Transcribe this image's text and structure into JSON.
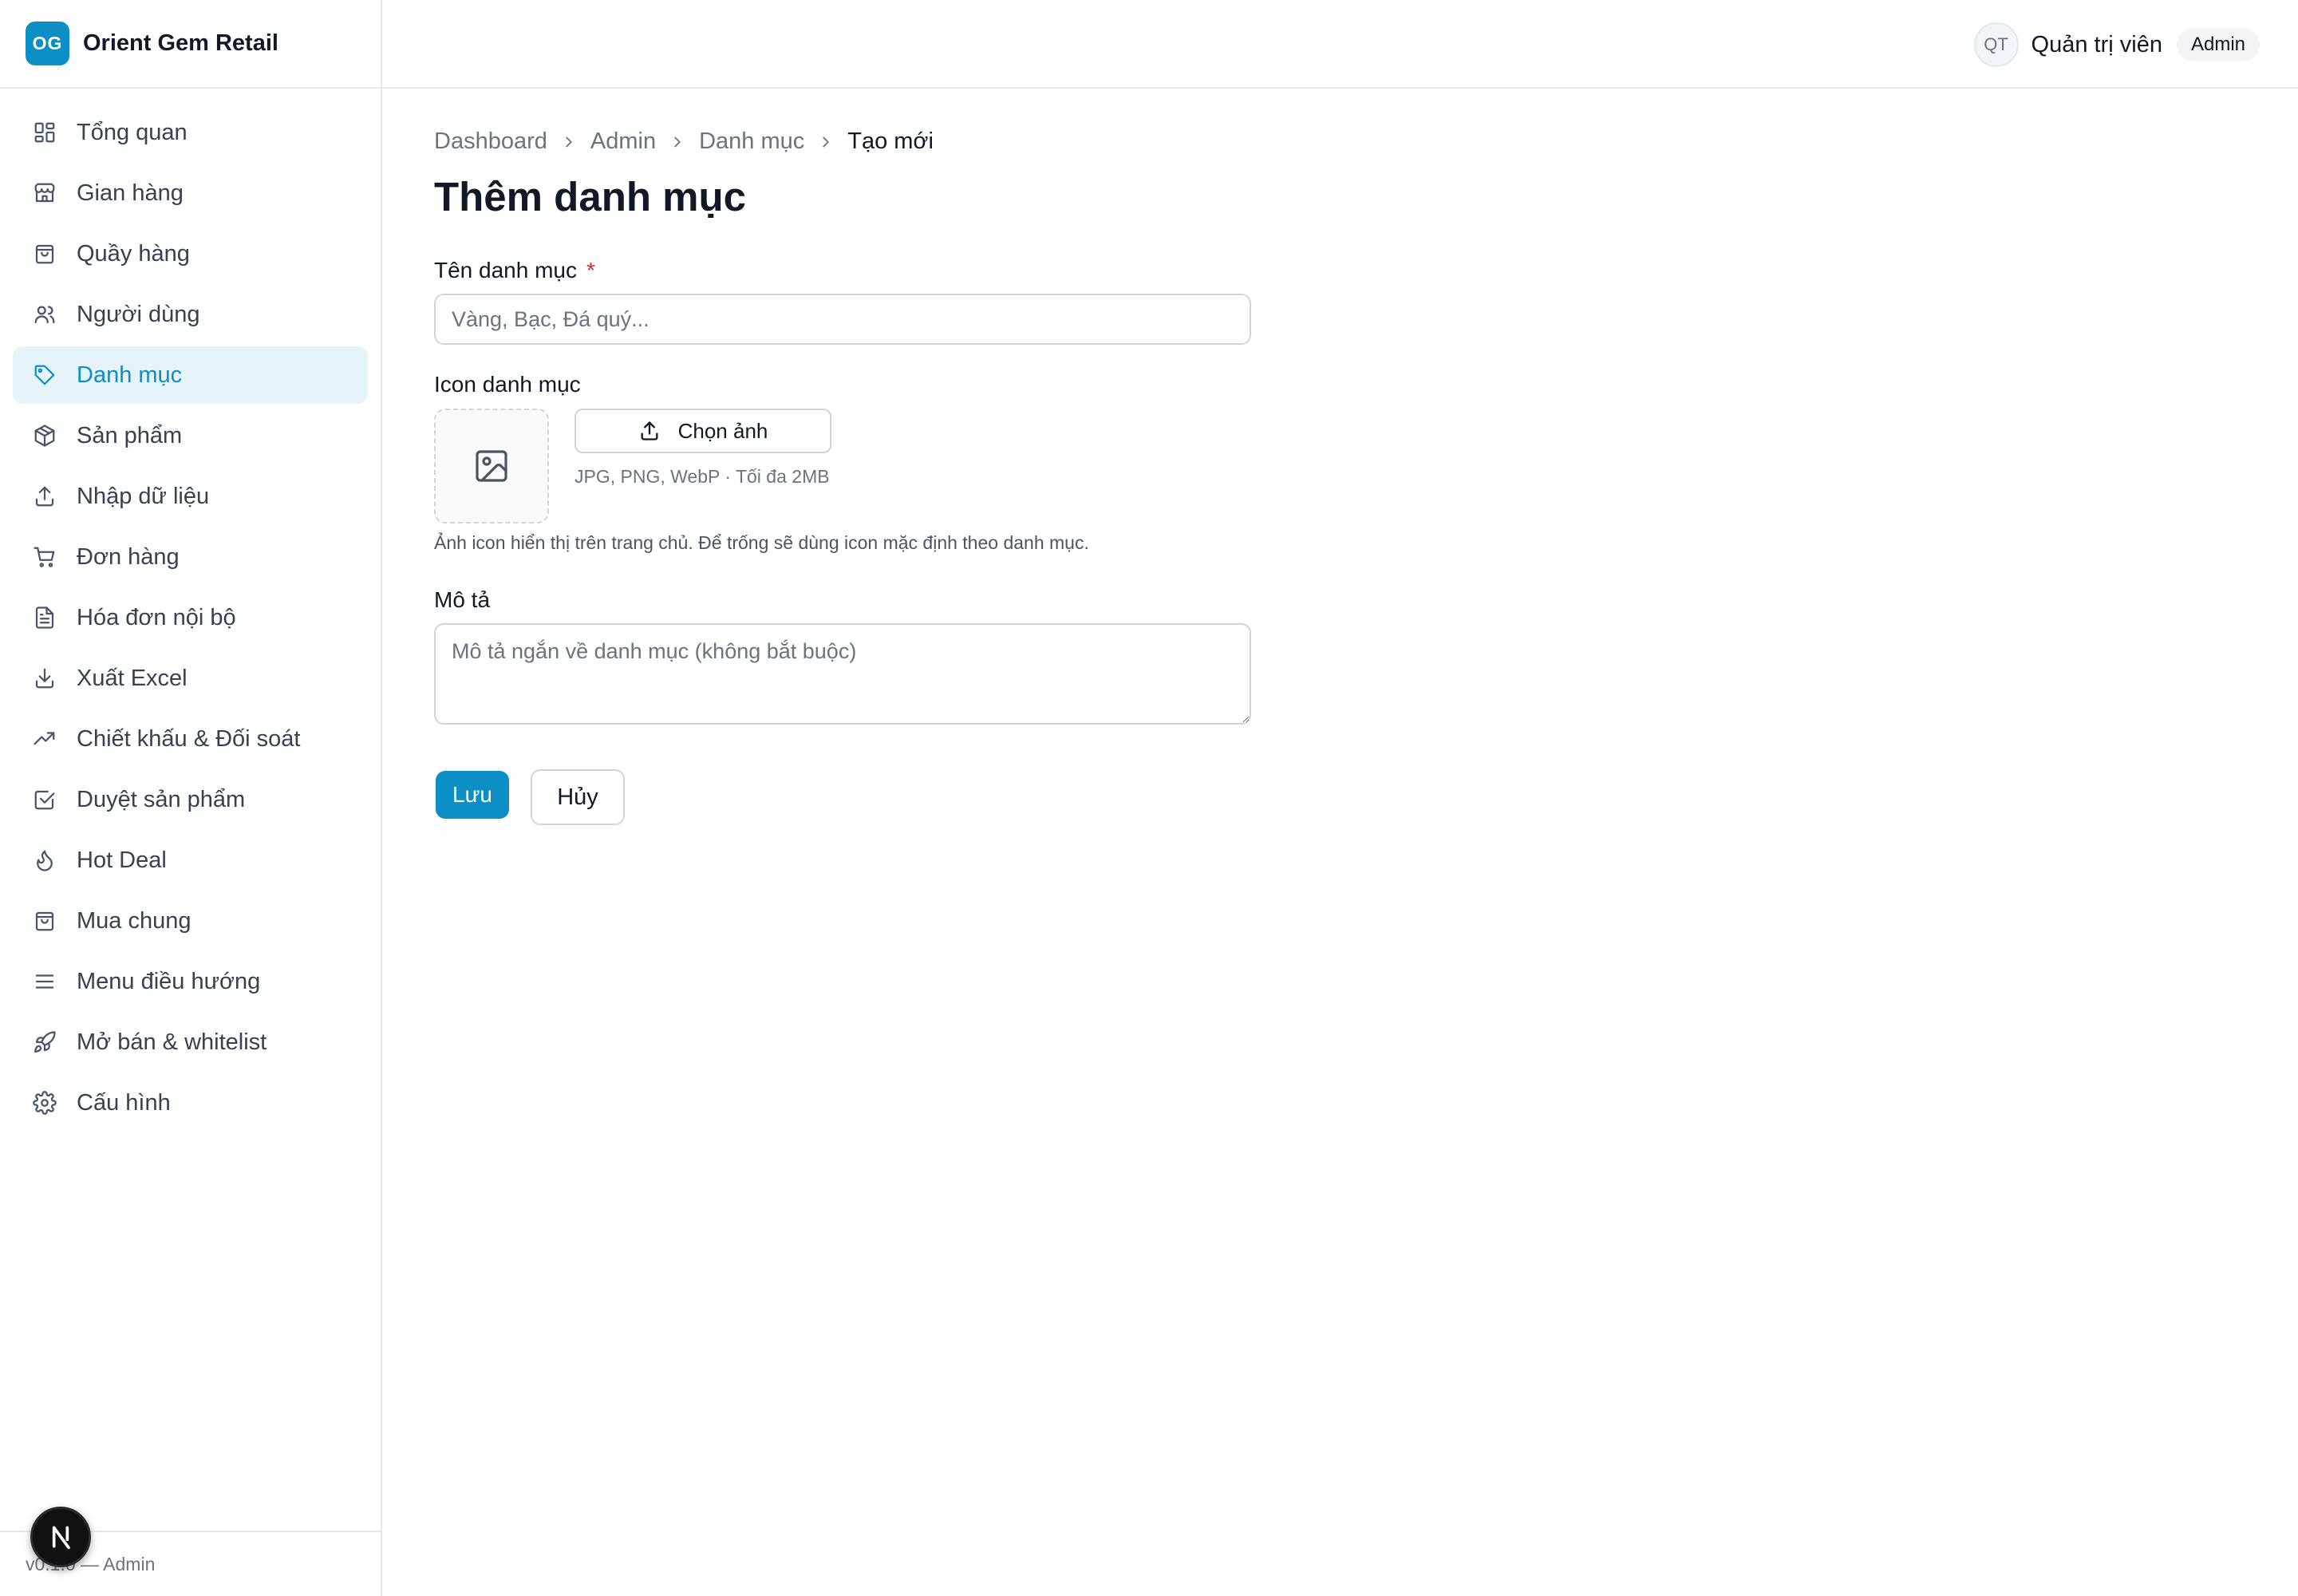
{
  "brand": {
    "logo_text": "OG",
    "name": "Orient Gem Retail",
    "accent_color": "#0b8fc4"
  },
  "sidebar": {
    "items": [
      {
        "label": "Tổng quan",
        "icon": "dashboard-grid-icon"
      },
      {
        "label": "Gian hàng",
        "icon": "store-icon"
      },
      {
        "label": "Quầy hàng",
        "icon": "shopping-bag-icon"
      },
      {
        "label": "Người dùng",
        "icon": "users-icon"
      },
      {
        "label": "Danh mục",
        "icon": "tag-icon",
        "active": true
      },
      {
        "label": "Sản phẩm",
        "icon": "package-icon"
      },
      {
        "label": "Nhập dữ liệu",
        "icon": "upload-icon"
      },
      {
        "label": "Đơn hàng",
        "icon": "shopping-cart-icon"
      },
      {
        "label": "Hóa đơn nội bộ",
        "icon": "file-text-icon"
      },
      {
        "label": "Xuất Excel",
        "icon": "download-icon"
      },
      {
        "label": "Chiết khấu & Đối soát",
        "icon": "trending-up-icon"
      },
      {
        "label": "Duyệt sản phẩm",
        "icon": "check-square-icon"
      },
      {
        "label": "Hot Deal",
        "icon": "flame-icon"
      },
      {
        "label": "Mua chung",
        "icon": "shopping-bag-icon"
      },
      {
        "label": "Menu điều hướng",
        "icon": "menu-icon"
      },
      {
        "label": "Mở bán & whitelist",
        "icon": "rocket-icon"
      },
      {
        "label": "Cấu hình",
        "icon": "gear-icon"
      }
    ],
    "footer_text": "v0.1.0 — Admin"
  },
  "header": {
    "avatar_initials": "QT",
    "user_name": "Quản trị viên",
    "role_badge": "Admin"
  },
  "breadcrumb": {
    "items": [
      "Dashboard",
      "Admin",
      "Danh mục"
    ],
    "current": "Tạo mới"
  },
  "page": {
    "title": "Thêm danh mục"
  },
  "form": {
    "name_label": "Tên danh mục",
    "required_mark": "*",
    "name_placeholder": "Vàng, Bạc, Đá quý...",
    "name_value": "",
    "icon_label": "Icon danh mục",
    "upload_button": "Chọn ảnh",
    "upload_hint": "JPG, PNG, WebP · Tối đa 2MB",
    "icon_help": "Ảnh icon hiển thị trên trang chủ. Để trống sẽ dùng icon mặc định theo danh mục.",
    "description_label": "Mô tả",
    "description_placeholder": "Mô tả ngắn về danh mục (không bắt buộc)",
    "description_value": "",
    "save_button": "Lưu",
    "cancel_button": "Hủy"
  }
}
